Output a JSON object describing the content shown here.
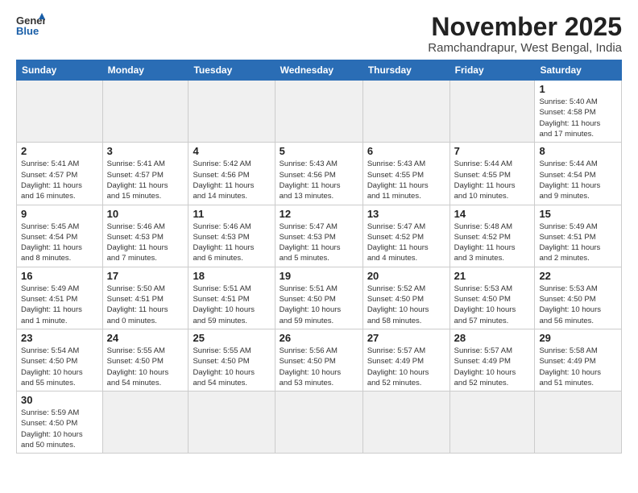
{
  "logo": {
    "text_general": "General",
    "text_blue": "Blue"
  },
  "header": {
    "month": "November 2025",
    "location": "Ramchandrapur, West Bengal, India"
  },
  "weekdays": [
    "Sunday",
    "Monday",
    "Tuesday",
    "Wednesday",
    "Thursday",
    "Friday",
    "Saturday"
  ],
  "weeks": [
    [
      {
        "day": "",
        "info": ""
      },
      {
        "day": "",
        "info": ""
      },
      {
        "day": "",
        "info": ""
      },
      {
        "day": "",
        "info": ""
      },
      {
        "day": "",
        "info": ""
      },
      {
        "day": "",
        "info": ""
      },
      {
        "day": "1",
        "info": "Sunrise: 5:40 AM\nSunset: 4:58 PM\nDaylight: 11 hours\nand 17 minutes."
      }
    ],
    [
      {
        "day": "2",
        "info": "Sunrise: 5:41 AM\nSunset: 4:57 PM\nDaylight: 11 hours\nand 16 minutes."
      },
      {
        "day": "3",
        "info": "Sunrise: 5:41 AM\nSunset: 4:57 PM\nDaylight: 11 hours\nand 15 minutes."
      },
      {
        "day": "4",
        "info": "Sunrise: 5:42 AM\nSunset: 4:56 PM\nDaylight: 11 hours\nand 14 minutes."
      },
      {
        "day": "5",
        "info": "Sunrise: 5:43 AM\nSunset: 4:56 PM\nDaylight: 11 hours\nand 13 minutes."
      },
      {
        "day": "6",
        "info": "Sunrise: 5:43 AM\nSunset: 4:55 PM\nDaylight: 11 hours\nand 11 minutes."
      },
      {
        "day": "7",
        "info": "Sunrise: 5:44 AM\nSunset: 4:55 PM\nDaylight: 11 hours\nand 10 minutes."
      },
      {
        "day": "8",
        "info": "Sunrise: 5:44 AM\nSunset: 4:54 PM\nDaylight: 11 hours\nand 9 minutes."
      }
    ],
    [
      {
        "day": "9",
        "info": "Sunrise: 5:45 AM\nSunset: 4:54 PM\nDaylight: 11 hours\nand 8 minutes."
      },
      {
        "day": "10",
        "info": "Sunrise: 5:46 AM\nSunset: 4:53 PM\nDaylight: 11 hours\nand 7 minutes."
      },
      {
        "day": "11",
        "info": "Sunrise: 5:46 AM\nSunset: 4:53 PM\nDaylight: 11 hours\nand 6 minutes."
      },
      {
        "day": "12",
        "info": "Sunrise: 5:47 AM\nSunset: 4:53 PM\nDaylight: 11 hours\nand 5 minutes."
      },
      {
        "day": "13",
        "info": "Sunrise: 5:47 AM\nSunset: 4:52 PM\nDaylight: 11 hours\nand 4 minutes."
      },
      {
        "day": "14",
        "info": "Sunrise: 5:48 AM\nSunset: 4:52 PM\nDaylight: 11 hours\nand 3 minutes."
      },
      {
        "day": "15",
        "info": "Sunrise: 5:49 AM\nSunset: 4:51 PM\nDaylight: 11 hours\nand 2 minutes."
      }
    ],
    [
      {
        "day": "16",
        "info": "Sunrise: 5:49 AM\nSunset: 4:51 PM\nDaylight: 11 hours\nand 1 minute."
      },
      {
        "day": "17",
        "info": "Sunrise: 5:50 AM\nSunset: 4:51 PM\nDaylight: 11 hours\nand 0 minutes."
      },
      {
        "day": "18",
        "info": "Sunrise: 5:51 AM\nSunset: 4:51 PM\nDaylight: 10 hours\nand 59 minutes."
      },
      {
        "day": "19",
        "info": "Sunrise: 5:51 AM\nSunset: 4:50 PM\nDaylight: 10 hours\nand 59 minutes."
      },
      {
        "day": "20",
        "info": "Sunrise: 5:52 AM\nSunset: 4:50 PM\nDaylight: 10 hours\nand 58 minutes."
      },
      {
        "day": "21",
        "info": "Sunrise: 5:53 AM\nSunset: 4:50 PM\nDaylight: 10 hours\nand 57 minutes."
      },
      {
        "day": "22",
        "info": "Sunrise: 5:53 AM\nSunset: 4:50 PM\nDaylight: 10 hours\nand 56 minutes."
      }
    ],
    [
      {
        "day": "23",
        "info": "Sunrise: 5:54 AM\nSunset: 4:50 PM\nDaylight: 10 hours\nand 55 minutes."
      },
      {
        "day": "24",
        "info": "Sunrise: 5:55 AM\nSunset: 4:50 PM\nDaylight: 10 hours\nand 54 minutes."
      },
      {
        "day": "25",
        "info": "Sunrise: 5:55 AM\nSunset: 4:50 PM\nDaylight: 10 hours\nand 54 minutes."
      },
      {
        "day": "26",
        "info": "Sunrise: 5:56 AM\nSunset: 4:50 PM\nDaylight: 10 hours\nand 53 minutes."
      },
      {
        "day": "27",
        "info": "Sunrise: 5:57 AM\nSunset: 4:49 PM\nDaylight: 10 hours\nand 52 minutes."
      },
      {
        "day": "28",
        "info": "Sunrise: 5:57 AM\nSunset: 4:49 PM\nDaylight: 10 hours\nand 52 minutes."
      },
      {
        "day": "29",
        "info": "Sunrise: 5:58 AM\nSunset: 4:49 PM\nDaylight: 10 hours\nand 51 minutes."
      }
    ],
    [
      {
        "day": "30",
        "info": "Sunrise: 5:59 AM\nSunset: 4:50 PM\nDaylight: 10 hours\nand 50 minutes."
      },
      {
        "day": "",
        "info": ""
      },
      {
        "day": "",
        "info": ""
      },
      {
        "day": "",
        "info": ""
      },
      {
        "day": "",
        "info": ""
      },
      {
        "day": "",
        "info": ""
      },
      {
        "day": "",
        "info": ""
      }
    ]
  ]
}
